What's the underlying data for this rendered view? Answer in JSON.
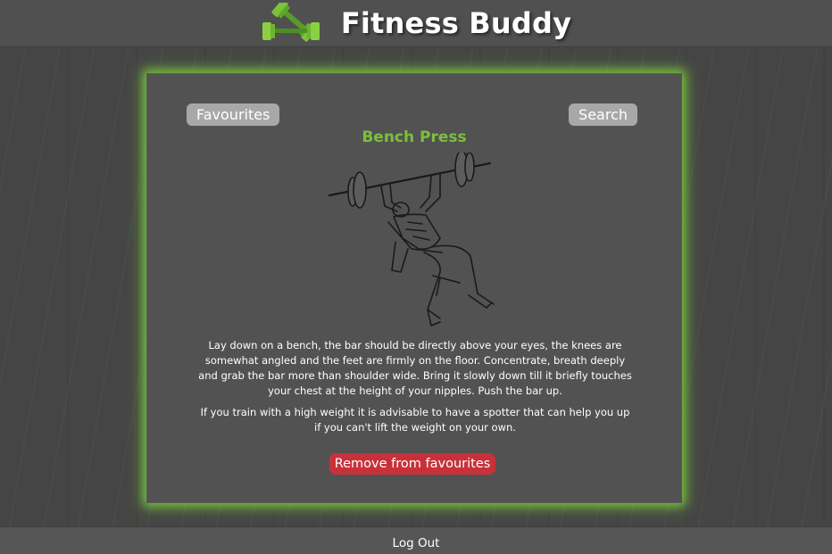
{
  "header": {
    "brand": "Fitness Buddy",
    "logo_icon": "dumbbells-icon"
  },
  "card": {
    "favourites_label": "Favourites",
    "search_label": "Search",
    "exercise_title": "Bench Press",
    "exercise_image": "bench-press-illustration",
    "description": [
      "Lay down on a bench, the bar should be directly above your eyes, the knees are somewhat angled and the feet are firmly on the floor. Concentrate, breath deeply and grab the bar more than shoulder wide. Bring it slowly down till it briefly touches your chest at the height of your nipples. Push the bar up.",
      "If you train with a high weight it is advisable to have a spotter that can help you up if you can't lift the weight on your own."
    ],
    "remove_label": "Remove from favourites"
  },
  "footer": {
    "logout_label": "Log Out"
  },
  "colors": {
    "accent_green": "#7dbe3d",
    "glow_green": "#76c13b",
    "danger_red": "#c8313a",
    "button_grey": "#a8a8a8"
  }
}
